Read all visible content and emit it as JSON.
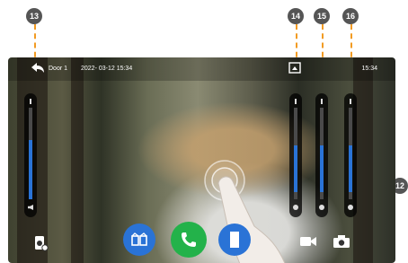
{
  "header": {
    "door": "Door 1",
    "datetime": "2022- 03-12 15:34",
    "time": "15:34"
  },
  "callouts": {
    "c12": "12",
    "c13": "13",
    "c14": "14",
    "c15": "15",
    "c16": "16"
  },
  "sliders": {
    "volume": 0.45,
    "brightness": 0.45,
    "contrast": 0.45,
    "color": 0.45
  },
  "colors": {
    "callout": "#f29b23",
    "slider_fill": "#2a73d6",
    "unlock_button": "#2a73d6",
    "answer_button": "#23b24a"
  },
  "icons": {
    "back": "back-arrow-icon",
    "snapshot_top": "capture-icon",
    "monitor": "monitor-icon",
    "unlock": "gate-icon",
    "answer": "phone-icon",
    "door": "door-icon",
    "record": "video-icon",
    "camera": "camera-icon"
  }
}
